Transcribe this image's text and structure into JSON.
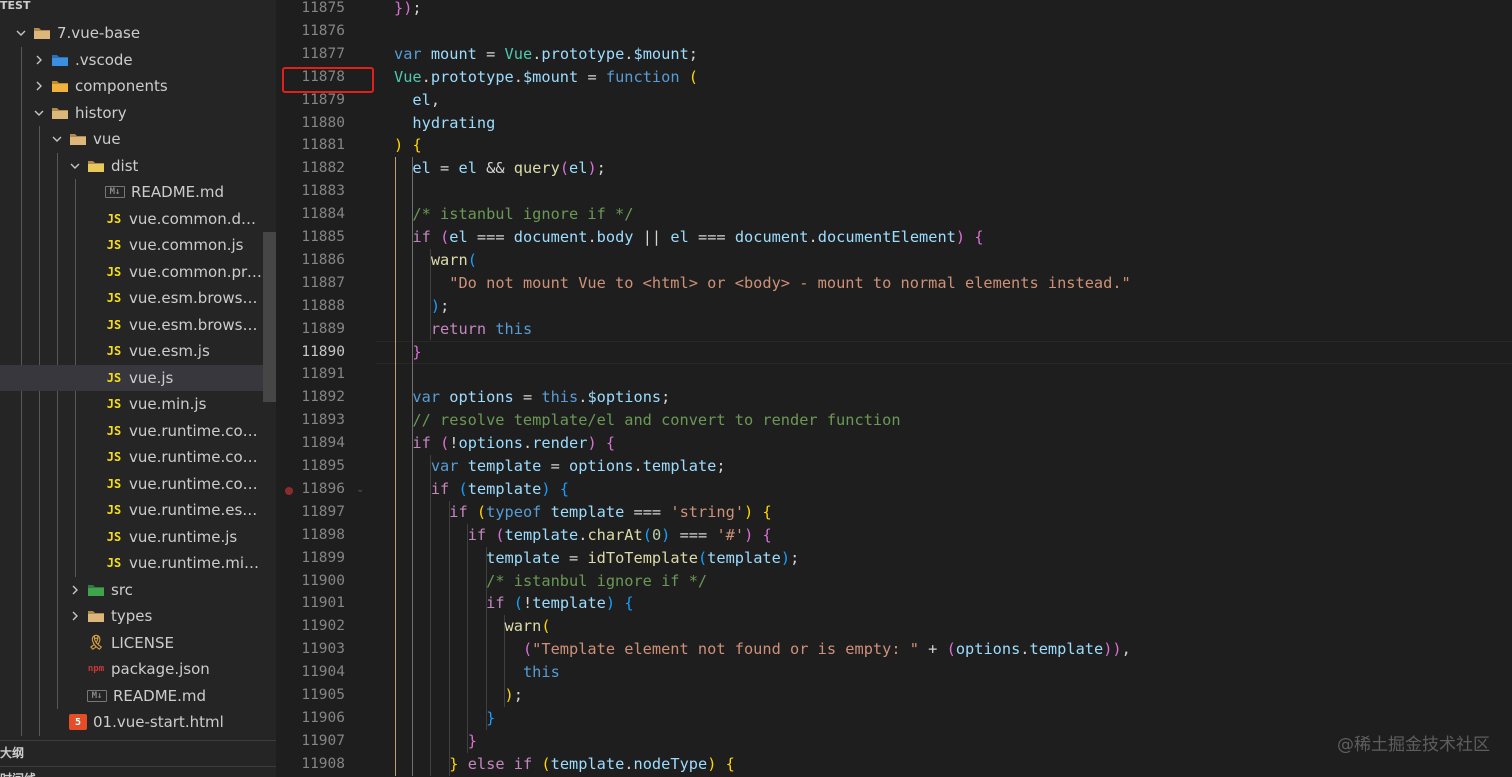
{
  "explorer": {
    "section_title": "TEST",
    "outline_title": "大纲",
    "timeline_title": "时间线",
    "items": [
      {
        "label": "7.vue-base",
        "depth": 0,
        "type": "folder-open",
        "expanded": true
      },
      {
        "label": ".vscode",
        "depth": 1,
        "type": "folder-vscode",
        "expanded": false
      },
      {
        "label": "components",
        "depth": 1,
        "type": "folder-components",
        "expanded": false
      },
      {
        "label": "history",
        "depth": 1,
        "type": "folder-open",
        "expanded": true
      },
      {
        "label": "vue",
        "depth": 2,
        "type": "folder-open",
        "expanded": true
      },
      {
        "label": "dist",
        "depth": 3,
        "type": "folder-dist",
        "expanded": true
      },
      {
        "label": "README.md",
        "depth": 4,
        "type": "md"
      },
      {
        "label": "vue.common.dev.js",
        "depth": 4,
        "type": "js"
      },
      {
        "label": "vue.common.js",
        "depth": 4,
        "type": "js"
      },
      {
        "label": "vue.common.prod.js",
        "depth": 4,
        "type": "js"
      },
      {
        "label": "vue.esm.browser.js",
        "depth": 4,
        "type": "js"
      },
      {
        "label": "vue.esm.browser.min.js",
        "depth": 4,
        "type": "js"
      },
      {
        "label": "vue.esm.js",
        "depth": 4,
        "type": "js"
      },
      {
        "label": "vue.js",
        "depth": 4,
        "type": "js",
        "selected": true
      },
      {
        "label": "vue.min.js",
        "depth": 4,
        "type": "js"
      },
      {
        "label": "vue.runtime.common.d...",
        "depth": 4,
        "type": "js"
      },
      {
        "label": "vue.runtime.common.js",
        "depth": 4,
        "type": "js"
      },
      {
        "label": "vue.runtime.common.pr...",
        "depth": 4,
        "type": "js"
      },
      {
        "label": "vue.runtime.esm.js",
        "depth": 4,
        "type": "js"
      },
      {
        "label": "vue.runtime.js",
        "depth": 4,
        "type": "js"
      },
      {
        "label": "vue.runtime.min.js",
        "depth": 4,
        "type": "js"
      },
      {
        "label": "src",
        "depth": 3,
        "type": "folder-src",
        "expanded": false
      },
      {
        "label": "types",
        "depth": 3,
        "type": "folder",
        "expanded": false
      },
      {
        "label": "LICENSE",
        "depth": 3,
        "type": "license"
      },
      {
        "label": "package.json",
        "depth": 3,
        "type": "json"
      },
      {
        "label": "README.md",
        "depth": 3,
        "type": "md"
      },
      {
        "label": "01.vue-start.html",
        "depth": 2,
        "type": "html"
      }
    ]
  },
  "editor": {
    "active_line": "11890",
    "highlighted_line": "11878",
    "breakpoint_line": "11896",
    "line_numbers": [
      "11875",
      "11876",
      "11877",
      "11878",
      "11879",
      "11880",
      "11881",
      "11882",
      "11883",
      "11884",
      "11885",
      "11886",
      "11887",
      "11888",
      "11889",
      "11890",
      "11891",
      "11892",
      "11893",
      "11894",
      "11895",
      "11896",
      "11897",
      "11898",
      "11899",
      "11900",
      "11901",
      "11902",
      "11903",
      "11904",
      "11905",
      "11906",
      "11907",
      "11908"
    ],
    "lines": [
      [
        [
          "b2",
          "})"
        ],
        [
          "p",
          ";"
        ]
      ],
      [],
      [
        [
          "k",
          "var "
        ],
        [
          "v",
          "mount"
        ],
        [
          "p",
          " = "
        ],
        [
          "t",
          "Vue"
        ],
        [
          "p",
          "."
        ],
        [
          "v",
          "prototype"
        ],
        [
          "p",
          "."
        ],
        [
          "v",
          "$mount"
        ],
        [
          "p",
          ";"
        ]
      ],
      [
        [
          "t",
          "Vue"
        ],
        [
          "p",
          "."
        ],
        [
          "v",
          "prototype"
        ],
        [
          "p",
          "."
        ],
        [
          "v",
          "$mount"
        ],
        [
          "p",
          " = "
        ],
        [
          "k",
          "function"
        ],
        [
          "p",
          " "
        ],
        [
          "b1",
          "("
        ]
      ],
      [
        [
          "p",
          "  "
        ],
        [
          "v",
          "el"
        ],
        [
          "p",
          ","
        ]
      ],
      [
        [
          "p",
          "  "
        ],
        [
          "v",
          "hydrating"
        ]
      ],
      [
        [
          "b1",
          ")"
        ],
        [
          "p",
          " "
        ],
        [
          "b1",
          "{"
        ]
      ],
      [
        [
          "p",
          "  "
        ],
        [
          "v",
          "el"
        ],
        [
          "p",
          " = "
        ],
        [
          "v",
          "el"
        ],
        [
          "p",
          " && "
        ],
        [
          "f",
          "query"
        ],
        [
          "b2",
          "("
        ],
        [
          "v",
          "el"
        ],
        [
          "b2",
          ")"
        ],
        [
          "p",
          ";"
        ]
      ],
      [],
      [
        [
          "p",
          "  "
        ],
        [
          "cm",
          "/* istanbul ignore if */"
        ]
      ],
      [
        [
          "p",
          "  "
        ],
        [
          "c",
          "if"
        ],
        [
          "p",
          " "
        ],
        [
          "b2",
          "("
        ],
        [
          "v",
          "el"
        ],
        [
          "p",
          " === "
        ],
        [
          "v",
          "document"
        ],
        [
          "p",
          "."
        ],
        [
          "v",
          "body"
        ],
        [
          "p",
          " || "
        ],
        [
          "v",
          "el"
        ],
        [
          "p",
          " === "
        ],
        [
          "v",
          "document"
        ],
        [
          "p",
          "."
        ],
        [
          "v",
          "documentElement"
        ],
        [
          "b2",
          ")"
        ],
        [
          "p",
          " "
        ],
        [
          "b2",
          "{"
        ]
      ],
      [
        [
          "p",
          "    "
        ],
        [
          "f",
          "warn"
        ],
        [
          "b3",
          "("
        ]
      ],
      [
        [
          "p",
          "      "
        ],
        [
          "s",
          "\"Do not mount Vue to <html> or <body> - mount to normal elements instead.\""
        ]
      ],
      [
        [
          "p",
          "    "
        ],
        [
          "b3",
          ")"
        ],
        [
          "p",
          ";"
        ]
      ],
      [
        [
          "p",
          "    "
        ],
        [
          "c",
          "return"
        ],
        [
          "p",
          " "
        ],
        [
          "k",
          "this"
        ]
      ],
      [
        [
          "p",
          "  "
        ],
        [
          "b2",
          "}"
        ]
      ],
      [],
      [
        [
          "p",
          "  "
        ],
        [
          "k",
          "var "
        ],
        [
          "v",
          "options"
        ],
        [
          "p",
          " = "
        ],
        [
          "k",
          "this"
        ],
        [
          "p",
          "."
        ],
        [
          "v",
          "$options"
        ],
        [
          "p",
          ";"
        ]
      ],
      [
        [
          "p",
          "  "
        ],
        [
          "cm",
          "// resolve template/el and convert to render function"
        ]
      ],
      [
        [
          "p",
          "  "
        ],
        [
          "c",
          "if"
        ],
        [
          "p",
          " "
        ],
        [
          "b2",
          "("
        ],
        [
          "p",
          "!"
        ],
        [
          "v",
          "options"
        ],
        [
          "p",
          "."
        ],
        [
          "v",
          "render"
        ],
        [
          "b2",
          ")"
        ],
        [
          "p",
          " "
        ],
        [
          "b2",
          "{"
        ]
      ],
      [
        [
          "p",
          "    "
        ],
        [
          "k",
          "var "
        ],
        [
          "v",
          "template"
        ],
        [
          "p",
          " = "
        ],
        [
          "v",
          "options"
        ],
        [
          "p",
          "."
        ],
        [
          "v",
          "template"
        ],
        [
          "p",
          ";"
        ]
      ],
      [
        [
          "p",
          "    "
        ],
        [
          "c",
          "if"
        ],
        [
          "p",
          " "
        ],
        [
          "b3",
          "("
        ],
        [
          "v",
          "template"
        ],
        [
          "b3",
          ")"
        ],
        [
          "p",
          " "
        ],
        [
          "b3",
          "{"
        ]
      ],
      [
        [
          "p",
          "      "
        ],
        [
          "c",
          "if"
        ],
        [
          "p",
          " "
        ],
        [
          "b1",
          "("
        ],
        [
          "k",
          "typeof"
        ],
        [
          "p",
          " "
        ],
        [
          "v",
          "template"
        ],
        [
          "p",
          " === "
        ],
        [
          "s",
          "'string'"
        ],
        [
          "b1",
          ")"
        ],
        [
          "p",
          " "
        ],
        [
          "b1",
          "{"
        ]
      ],
      [
        [
          "p",
          "        "
        ],
        [
          "c",
          "if"
        ],
        [
          "p",
          " "
        ],
        [
          "b2",
          "("
        ],
        [
          "v",
          "template"
        ],
        [
          "p",
          "."
        ],
        [
          "f",
          "charAt"
        ],
        [
          "b3",
          "("
        ],
        [
          "n",
          "0"
        ],
        [
          "b3",
          ")"
        ],
        [
          "p",
          " === "
        ],
        [
          "s",
          "'#'"
        ],
        [
          "b2",
          ")"
        ],
        [
          "p",
          " "
        ],
        [
          "b2",
          "{"
        ]
      ],
      [
        [
          "p",
          "          "
        ],
        [
          "v",
          "template"
        ],
        [
          "p",
          " = "
        ],
        [
          "f",
          "idToTemplate"
        ],
        [
          "b3",
          "("
        ],
        [
          "v",
          "template"
        ],
        [
          "b3",
          ")"
        ],
        [
          "p",
          ";"
        ]
      ],
      [
        [
          "p",
          "          "
        ],
        [
          "cm",
          "/* istanbul ignore if */"
        ]
      ],
      [
        [
          "p",
          "          "
        ],
        [
          "c",
          "if"
        ],
        [
          "p",
          " "
        ],
        [
          "b3",
          "("
        ],
        [
          "p",
          "!"
        ],
        [
          "v",
          "template"
        ],
        [
          "b3",
          ")"
        ],
        [
          "p",
          " "
        ],
        [
          "b3",
          "{"
        ]
      ],
      [
        [
          "p",
          "            "
        ],
        [
          "f",
          "warn"
        ],
        [
          "b1",
          "("
        ]
      ],
      [
        [
          "p",
          "              "
        ],
        [
          "b2",
          "("
        ],
        [
          "s",
          "\"Template element not found or is empty: \""
        ],
        [
          "p",
          " + "
        ],
        [
          "b2",
          "("
        ],
        [
          "v",
          "options"
        ],
        [
          "p",
          "."
        ],
        [
          "v",
          "template"
        ],
        [
          "b2",
          "))"
        ],
        [
          "p",
          ","
        ]
      ],
      [
        [
          "p",
          "              "
        ],
        [
          "k",
          "this"
        ]
      ],
      [
        [
          "p",
          "            "
        ],
        [
          "b1",
          ")"
        ],
        [
          "p",
          ";"
        ]
      ],
      [
        [
          "p",
          "          "
        ],
        [
          "b3",
          "}"
        ]
      ],
      [
        [
          "p",
          "        "
        ],
        [
          "b2",
          "}"
        ]
      ],
      [
        [
          "p",
          "      "
        ],
        [
          "b1",
          "}"
        ],
        [
          "p",
          " "
        ],
        [
          "c",
          "else if"
        ],
        [
          "p",
          " "
        ],
        [
          "b1",
          "("
        ],
        [
          "v",
          "template"
        ],
        [
          "p",
          "."
        ],
        [
          "v",
          "nodeType"
        ],
        [
          "b1",
          ")"
        ],
        [
          "p",
          " "
        ],
        [
          "b1",
          "{"
        ]
      ]
    ]
  },
  "watermark": "@稀土掘金技术社区"
}
